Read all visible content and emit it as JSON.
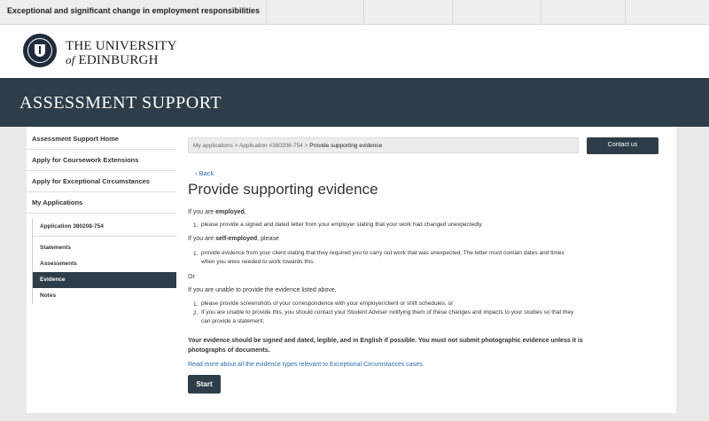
{
  "window": {
    "title": "Exceptional and significant change in employment responsibilities"
  },
  "brand": {
    "line1": "THE UNIVERSITY",
    "of": "of",
    "line2": "EDINBURGH"
  },
  "banner": {
    "title": "ASSESSMENT SUPPORT"
  },
  "sidebar": {
    "items": [
      {
        "label": "Assessment Support Home"
      },
      {
        "label": "Apply for Coursework Extensions"
      },
      {
        "label": "Apply for Exceptional Circumstances"
      },
      {
        "label": "My Applications"
      }
    ],
    "application": "Application 380208-754",
    "subitems": [
      {
        "label": "Statements"
      },
      {
        "label": "Assessments"
      },
      {
        "label": "Evidence"
      },
      {
        "label": "Notes"
      }
    ]
  },
  "breadcrumb": {
    "items": [
      "My applications",
      "Application #380208-754",
      "Provide supporting evidence"
    ],
    "separator": ">"
  },
  "contact_label": "Contact us",
  "back_label": "Back",
  "page_title": "Provide supporting evidence",
  "sections": {
    "employed_pre": "If you are ",
    "employed_bold": "employed",
    "employed_post": ",",
    "employed_items": [
      "please provide a signed and dated letter from your employer stating that your work had changed unexpectedly."
    ],
    "self_pre": "If you are ",
    "self_bold": "self-employed",
    "self_post": ", please",
    "self_items": [
      "provide evidence from your client stating that they required you to carry out work that was unexpected. The letter must contain dates and times",
      "when you were needed to work towards this."
    ],
    "or": "Or",
    "unable": "If you are unable to provide the evidence listed above,",
    "unable_items": [
      "please provide screenshots of your correspondence with your employer/client or shift schedules, or",
      "If you are unable to provide this, you should contact your Student Adviser notifying them of these changes and impacts to your studies so that they",
      "can provide a statement."
    ],
    "notice_line1": "Your evidence should be signed and dated, legible, and in English if possible. You must not submit photographic evidence unless it is",
    "notice_line2": "photographs of documents.",
    "read_more": "Read more about all the evidence types relevant to Exceptional Circumstances cases.",
    "start_label": "Start"
  }
}
